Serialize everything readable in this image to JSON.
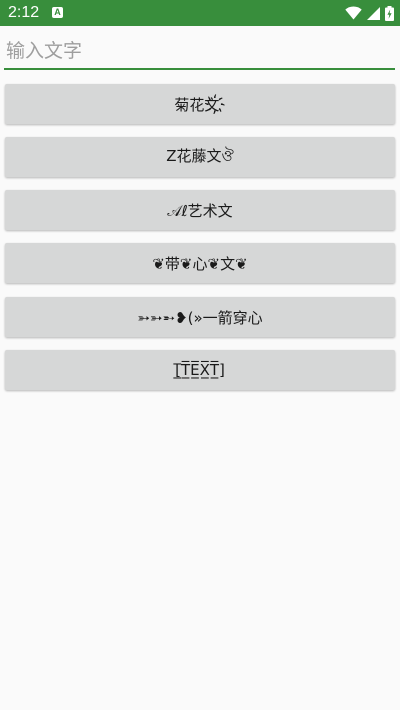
{
  "status_bar": {
    "time": "2:12",
    "notification_glyph": "A",
    "icons": [
      "wifi-icon",
      "signal-icon",
      "battery-charging-icon"
    ],
    "color": "#388e3c"
  },
  "input": {
    "placeholder": "输入文字",
    "value": "",
    "accent_color": "#388e3c"
  },
  "buttons": [
    {
      "label": "菊花文҉"
    },
    {
      "label": "Z花藤文ঔ"
    },
    {
      "label": "𝒜ℓ艺术文"
    },
    {
      "label": "❦带❦心❦文❦"
    },
    {
      "label": "➳➳➵❥(»一箭穿心"
    },
    {
      "label": "[̲̅T̲̅E̲̅X̲̅T̲̅]"
    }
  ]
}
